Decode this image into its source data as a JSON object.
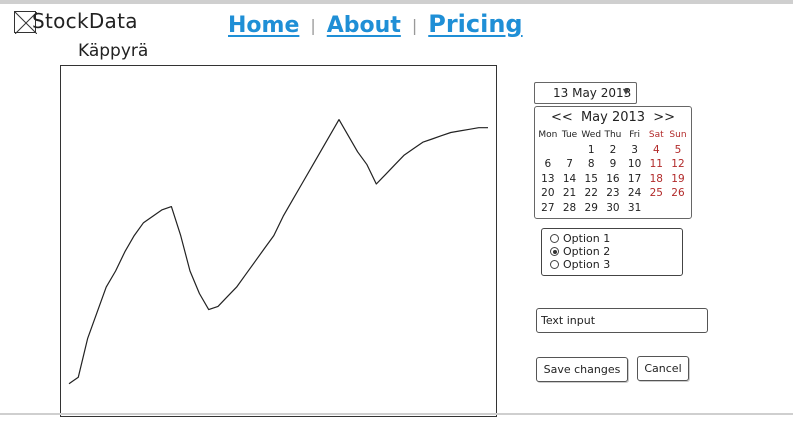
{
  "brand": {
    "name": "StockData",
    "logo_icon": "image-placeholder-icon"
  },
  "nav": {
    "home": "Home",
    "about": "About",
    "pricing": "Pricing",
    "separator": "|"
  },
  "chart": {
    "title": "Käppyrä"
  },
  "chart_data": {
    "type": "line",
    "title": "Käppyrä",
    "xlabel": "",
    "ylabel": "",
    "grid": false,
    "x": [
      0,
      1,
      2,
      3,
      4,
      5,
      6,
      7,
      8,
      9,
      10,
      11,
      12,
      13,
      14,
      15,
      16,
      17,
      18,
      19,
      20,
      21,
      22,
      23,
      24,
      25,
      26,
      27,
      28,
      29,
      30,
      31,
      32,
      33,
      34,
      35,
      36,
      37,
      38,
      39,
      40,
      41,
      42,
      43,
      44,
      45
    ],
    "series": [
      {
        "values": [
          6,
          8,
          20,
          28,
          36,
          41,
          47,
          52,
          56,
          58,
          60,
          61,
          52,
          41,
          34,
          29,
          30,
          33,
          36,
          40,
          44,
          48,
          52,
          58,
          63,
          68,
          73,
          78,
          83,
          88,
          83,
          78,
          74,
          68,
          71,
          74,
          77,
          79,
          81,
          82,
          83,
          84,
          84.5,
          85,
          85.5,
          85.5
        ]
      }
    ],
    "ylim": [
      0,
      100
    ]
  },
  "date_picker": {
    "value": "13 May 2013",
    "prev": "<<",
    "next": ">>",
    "month_label": "May 2013",
    "weekdays": [
      "Mon",
      "Tue",
      "Wed",
      "Thu",
      "Fri",
      "Sat",
      "Sun"
    ],
    "weeks": [
      [
        "",
        "",
        "1",
        "2",
        "3",
        "4",
        "5"
      ],
      [
        "6",
        "7",
        "8",
        "9",
        "10",
        "11",
        "12"
      ],
      [
        "13",
        "14",
        "15",
        "16",
        "17",
        "18",
        "19"
      ],
      [
        "20",
        "21",
        "22",
        "23",
        "24",
        "25",
        "26"
      ],
      [
        "27",
        "28",
        "29",
        "30",
        "31",
        "",
        ""
      ]
    ],
    "weekend_color": "#b22a2a"
  },
  "radio_group": {
    "options": [
      "Option 1",
      "Option 2",
      "Option 3"
    ],
    "selected": "Option 2"
  },
  "text_input": {
    "value": "Text input"
  },
  "actions": {
    "save": "Save changes",
    "cancel": "Cancel"
  },
  "colors": {
    "link": "#1f8fd6",
    "weekend": "#b22a2a"
  }
}
